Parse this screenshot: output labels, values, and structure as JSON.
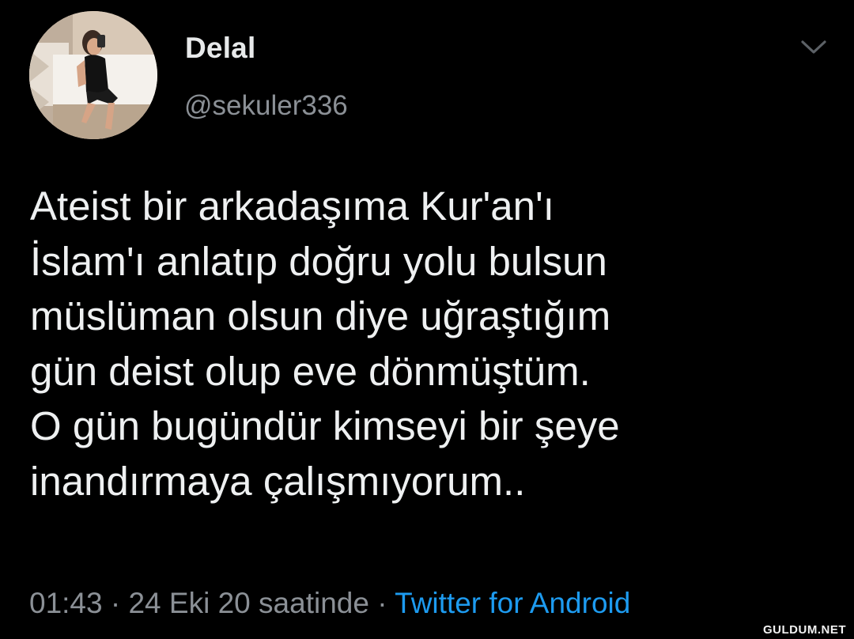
{
  "tweet": {
    "display_name": "Delal",
    "handle": "@sekuler336",
    "avatar_icon": "profile-photo-avatar",
    "menu_icon": "chevron-down-icon",
    "text_lines": [
      "Ateist bir arkadaşıma Kur'an'ı",
      "İslam'ı anlatıp doğru yolu bulsun",
      "müslüman olsun diye uğraştığım",
      "gün deist olup eve dönmüştüm.",
      "O gün bugündür kimseyi bir şeye",
      "inandırmaya çalışmıyorum.."
    ],
    "time": "01:43",
    "separator": " · ",
    "date": "24 Eki 20 saatinde",
    "source": "Twitter for Android"
  },
  "watermark": "GULDUM.NET",
  "colors": {
    "background": "#000000",
    "primary_text": "#e7e9ea",
    "secondary_text": "#8b9096",
    "link": "#1d9bf0"
  }
}
